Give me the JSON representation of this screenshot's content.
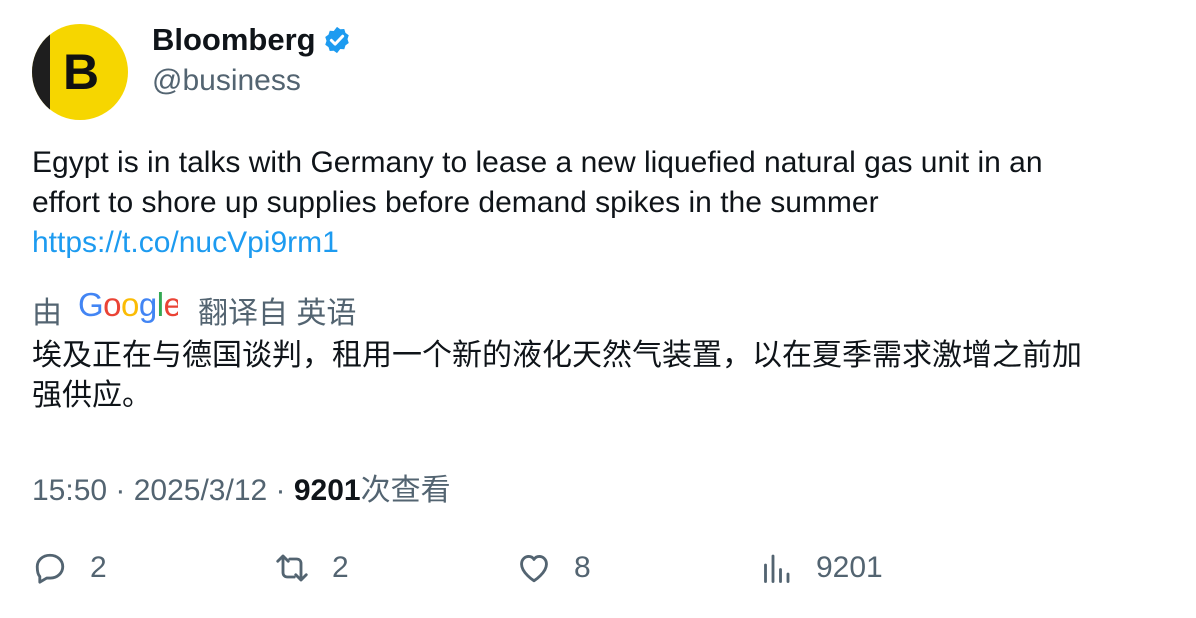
{
  "author": {
    "avatar_letter": "B",
    "display_name": "Bloomberg",
    "handle": "@business",
    "verified": true
  },
  "tweet": {
    "text_lines": [
      "Egypt is in talks with Germany to lease a new liquefied natural gas unit in an",
      "effort to shore up supplies before demand spikes in the summer"
    ],
    "link": "https://t.co/nucVpi9rm1"
  },
  "translation": {
    "prefix": "由",
    "provider": "Google",
    "suffix": "翻译自 英语",
    "text_lines": [
      "埃及正在与德国谈判，租用一个新的液化天然气装置，以在夏季需求激增之前加",
      "强供应。"
    ]
  },
  "meta": {
    "timestamp": "15:50 · 2025/3/12 · ",
    "views_count": "9201",
    "views_label": "次查看"
  },
  "actions": {
    "reply_count": "2",
    "retweet_count": "2",
    "like_count": "8",
    "views_count": "9201"
  },
  "colors": {
    "avatar_bg": "#f6d600",
    "verified": "#1d9bf0",
    "link": "#1d9bf0",
    "secondary_text": "#536471"
  },
  "icons": [
    "verified-badge-icon",
    "google-logo",
    "reply-icon",
    "retweet-icon",
    "like-icon",
    "views-icon"
  ]
}
